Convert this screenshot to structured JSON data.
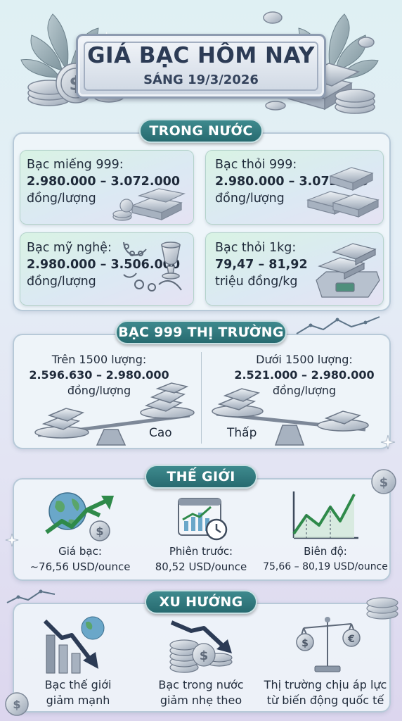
{
  "header": {
    "title": "GIÁ BẠC HÔM NAY",
    "subtitle": "SÁNG 19/3/2026"
  },
  "domestic": {
    "label": "TRONG NƯỚC",
    "cards": [
      {
        "name": "Bạc miếng 999:",
        "price": "2.980.000 – 3.072.000",
        "unit": "đồng/lượng",
        "icon": "silver-bars-coins-icon"
      },
      {
        "name": "Bạc thỏi 999:",
        "price": "2.980.000 – 3.072.000",
        "unit": "đồng/lượng",
        "icon": "silver-ingots-icon"
      },
      {
        "name": "Bạc mỹ nghệ:",
        "price": "2.980.000 – 3.506.000",
        "unit": "đồng/lượng",
        "icon": "silver-jewelry-icon"
      },
      {
        "name": "Bạc thỏi 1kg:",
        "price": "79,47 – 81,92",
        "unit": "triệu đồng/kg",
        "icon": "silver-scale-icon"
      }
    ]
  },
  "market": {
    "label": "BẠC 999 THỊ TRƯỜNG",
    "left": {
      "condition": "Trên 1500 lượng:",
      "price": "2.596.630 – 2.980.000",
      "unit": "đồng/lượng",
      "tag": "Cao"
    },
    "right": {
      "condition": "Dưới 1500 lượng:",
      "price": "2.521.000 – 2.980.000",
      "unit": "đồng/lượng",
      "tag": "Thấp"
    }
  },
  "world": {
    "label": "THẾ GIỚI",
    "items": [
      {
        "line1": "Giá bạc:",
        "line2": "~76,56 USD/ounce",
        "icon": "globe-rising-arrow-icon"
      },
      {
        "line1": "Phiên trước:",
        "line2": "80,52 USD/ounce",
        "icon": "calendar-chart-clock-icon"
      },
      {
        "line1": "Biên độ:",
        "line2": "75,66 – 80,19 USD/ounce",
        "icon": "line-chart-icon"
      }
    ]
  },
  "trend": {
    "label": "XU HƯỚNG",
    "items": [
      {
        "line1": "Bạc thế giới",
        "line2": "giảm mạnh",
        "icon": "falling-bar-chart-icon"
      },
      {
        "line1": "Bạc trong nước",
        "line2": "giảm nhẹ theo",
        "icon": "coins-down-arrow-icon"
      },
      {
        "line1": "Thị trường chịu áp lực",
        "line2": "từ biến động quốc tế",
        "icon": "currency-balance-icon"
      }
    ]
  },
  "colors": {
    "teal": "#2e777c",
    "navy": "#2c3b55",
    "silver": "#c9d2dd",
    "green": "#3aa35a"
  }
}
